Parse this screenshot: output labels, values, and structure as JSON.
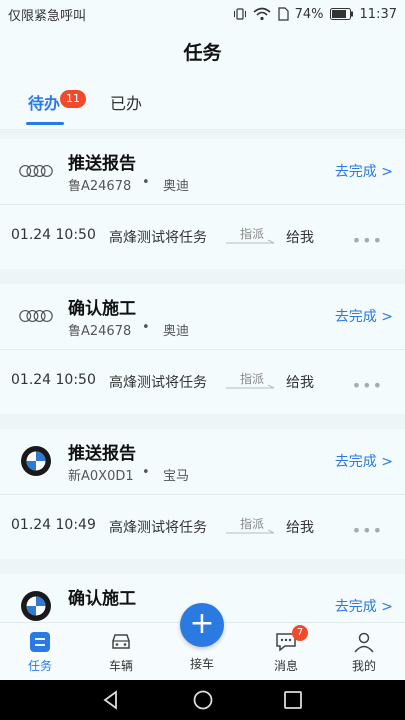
{
  "statusbar": {
    "left_text": "仅限紧急呼叫",
    "battery": "74%",
    "time": "11:37"
  },
  "page_title": "任务",
  "tabs": [
    {
      "label": "待办",
      "badge": "11",
      "active": true
    },
    {
      "label": "已办",
      "active": false
    }
  ],
  "tasks": [
    {
      "title": "推送报告",
      "plate": "鲁A24678",
      "brand": "奥迪",
      "logo": "audi-logo",
      "action": "去完成 >",
      "time": "01.24 10:50",
      "person": "高烽测试将任务",
      "assign_label": "指派",
      "to": "给我"
    },
    {
      "title": "确认施工",
      "plate": "鲁A24678",
      "brand": "奥迪",
      "logo": "audi-logo",
      "action": "去完成 >",
      "time": "01.24 10:50",
      "person": "高烽测试将任务",
      "assign_label": "指派",
      "to": "给我"
    },
    {
      "title": "推送报告",
      "plate": "新A0X0D1",
      "brand": "宝马",
      "logo": "bmw-logo",
      "action": "去完成 >",
      "time": "01.24 10:49",
      "person": "高烽测试将任务",
      "assign_label": "指派",
      "to": "给我"
    },
    {
      "title": "确认施工",
      "action": "去完成 >",
      "logo": "bmw-logo"
    }
  ],
  "dot_sep": "•",
  "more_dots": "•••",
  "bottom_nav": [
    {
      "label": "任务",
      "icon": "task-icon",
      "active": true
    },
    {
      "label": "车辆",
      "icon": "car-icon"
    },
    {
      "label": "接车",
      "icon": "plus-icon"
    },
    {
      "label": "消息",
      "icon": "message-icon",
      "badge": "7"
    },
    {
      "label": "我的",
      "icon": "user-icon"
    }
  ],
  "fab_symbol": "+",
  "colors": {
    "accent": "#2a7ae2",
    "badge": "#f04a2a",
    "background": "#f4fbfd"
  }
}
